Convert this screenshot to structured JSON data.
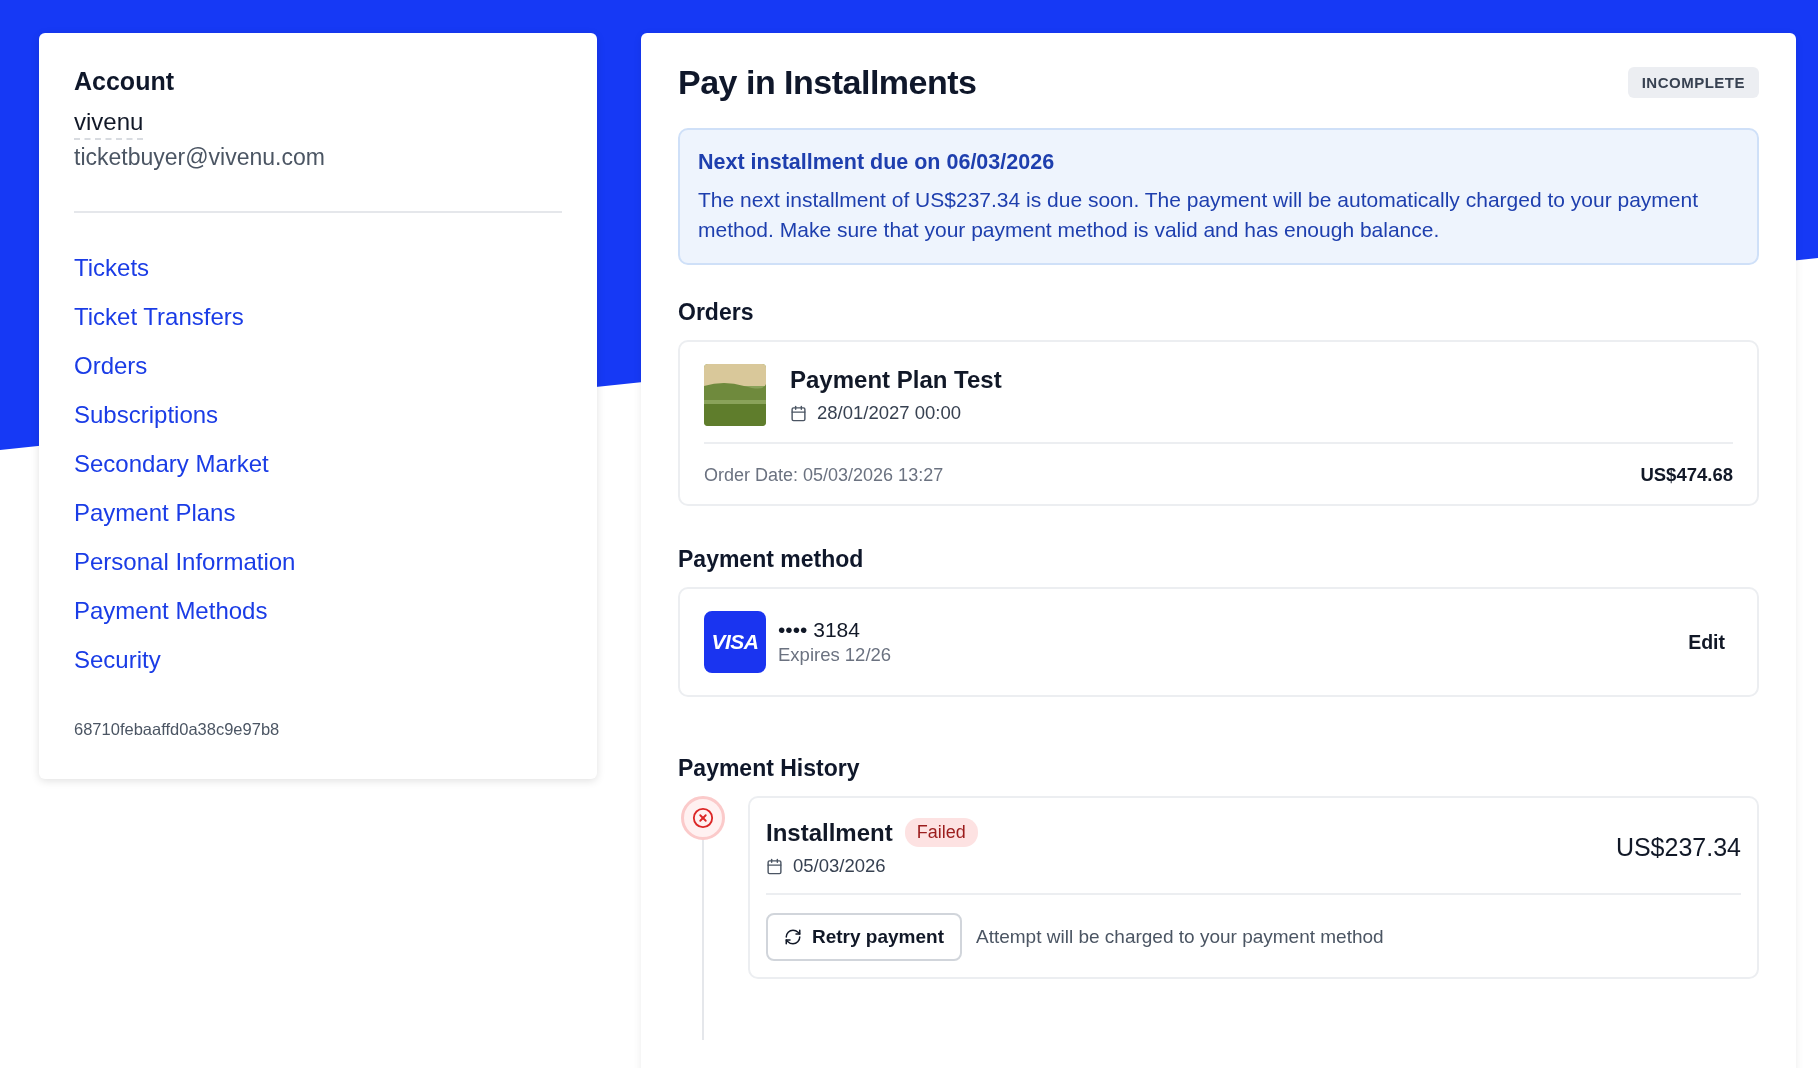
{
  "sidebar": {
    "heading": "Account",
    "username": "vivenu",
    "email": "ticketbuyer@vivenu.com",
    "nav": [
      {
        "label": "Tickets"
      },
      {
        "label": "Ticket Transfers"
      },
      {
        "label": "Orders"
      },
      {
        "label": "Subscriptions"
      },
      {
        "label": "Secondary Market"
      },
      {
        "label": "Payment Plans"
      },
      {
        "label": "Personal Information"
      },
      {
        "label": "Payment Methods"
      },
      {
        "label": "Security"
      }
    ],
    "account_id": "68710febaaffd0a38c9e97b8"
  },
  "page": {
    "title": "Pay in Installments",
    "status": "INCOMPLETE"
  },
  "notice": {
    "title": "Next installment due on 06/03/2026",
    "message": "The next installment of US$237.34 is due soon. The payment will be automatically charged to your payment method. Make sure that your payment method is valid and has enough balance."
  },
  "orders": {
    "heading": "Orders",
    "items": [
      {
        "event": "Payment Plan Test",
        "event_date": "28/01/2027 00:00",
        "order_date": "Order Date: 05/03/2026 13:27",
        "total": "US$474.68"
      }
    ]
  },
  "payment_method": {
    "heading": "Payment method",
    "brand": "VISA",
    "number": "•••• 3184",
    "expiry": "Expires 12/26",
    "action": "Edit"
  },
  "payment_history": {
    "heading": "Payment History",
    "entries": [
      {
        "kind": "failed",
        "title": "Installment",
        "badge": "Failed",
        "date": "05/03/2026",
        "amount": "US$237.34",
        "action": "Retry payment",
        "note": "Attempt will be charged to your payment method"
      }
    ]
  }
}
